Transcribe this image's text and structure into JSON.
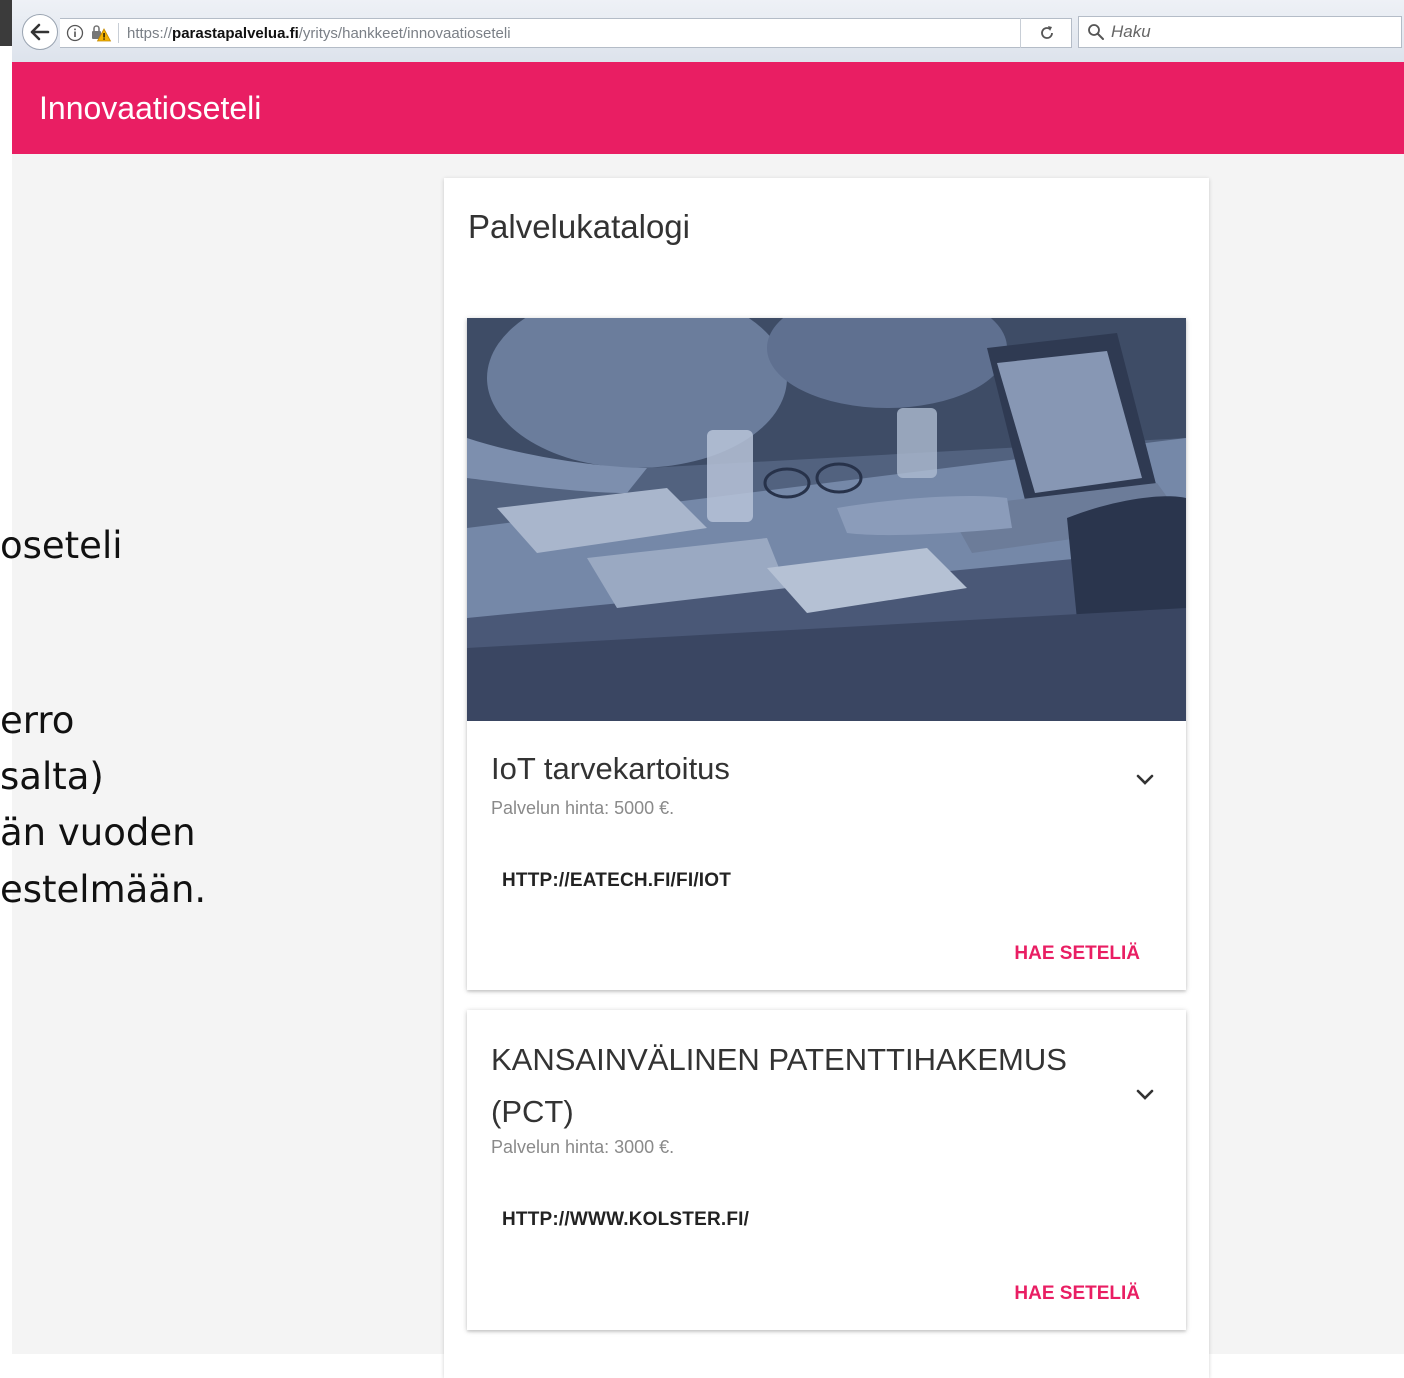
{
  "browser": {
    "url_scheme": "https://",
    "url_domain": "parastapalvelua.fi",
    "url_path": "/yritys/hankkeet/innovaatioseteli",
    "search_placeholder": "Haku"
  },
  "app": {
    "title": "Innovaatioseteli"
  },
  "background_slide": {
    "fragments": [
      "oseteli",
      "erro",
      "salta)",
      "än vuoden",
      "estelmään."
    ]
  },
  "catalog": {
    "title": "Palvelukatalogi",
    "services": [
      {
        "title": "IoT tarvekartoitus",
        "price": "Palvelun hinta: 5000 €.",
        "link": "HTTP://EATECH.FI/FI/IOT",
        "action": "HAE SETELIÄ"
      },
      {
        "title_line1": "KANSAINVÄLINEN PATENTTIHAKEMUS",
        "title_line2": "(PCT)",
        "price": "Palvelun hinta: 3000 €.",
        "link": "HTTP://WWW.KOLSTER.FI/",
        "action": "HAE SETELIÄ"
      }
    ]
  },
  "colors": {
    "accent": "#e91e63",
    "image_tint": "#5b6d8c"
  }
}
